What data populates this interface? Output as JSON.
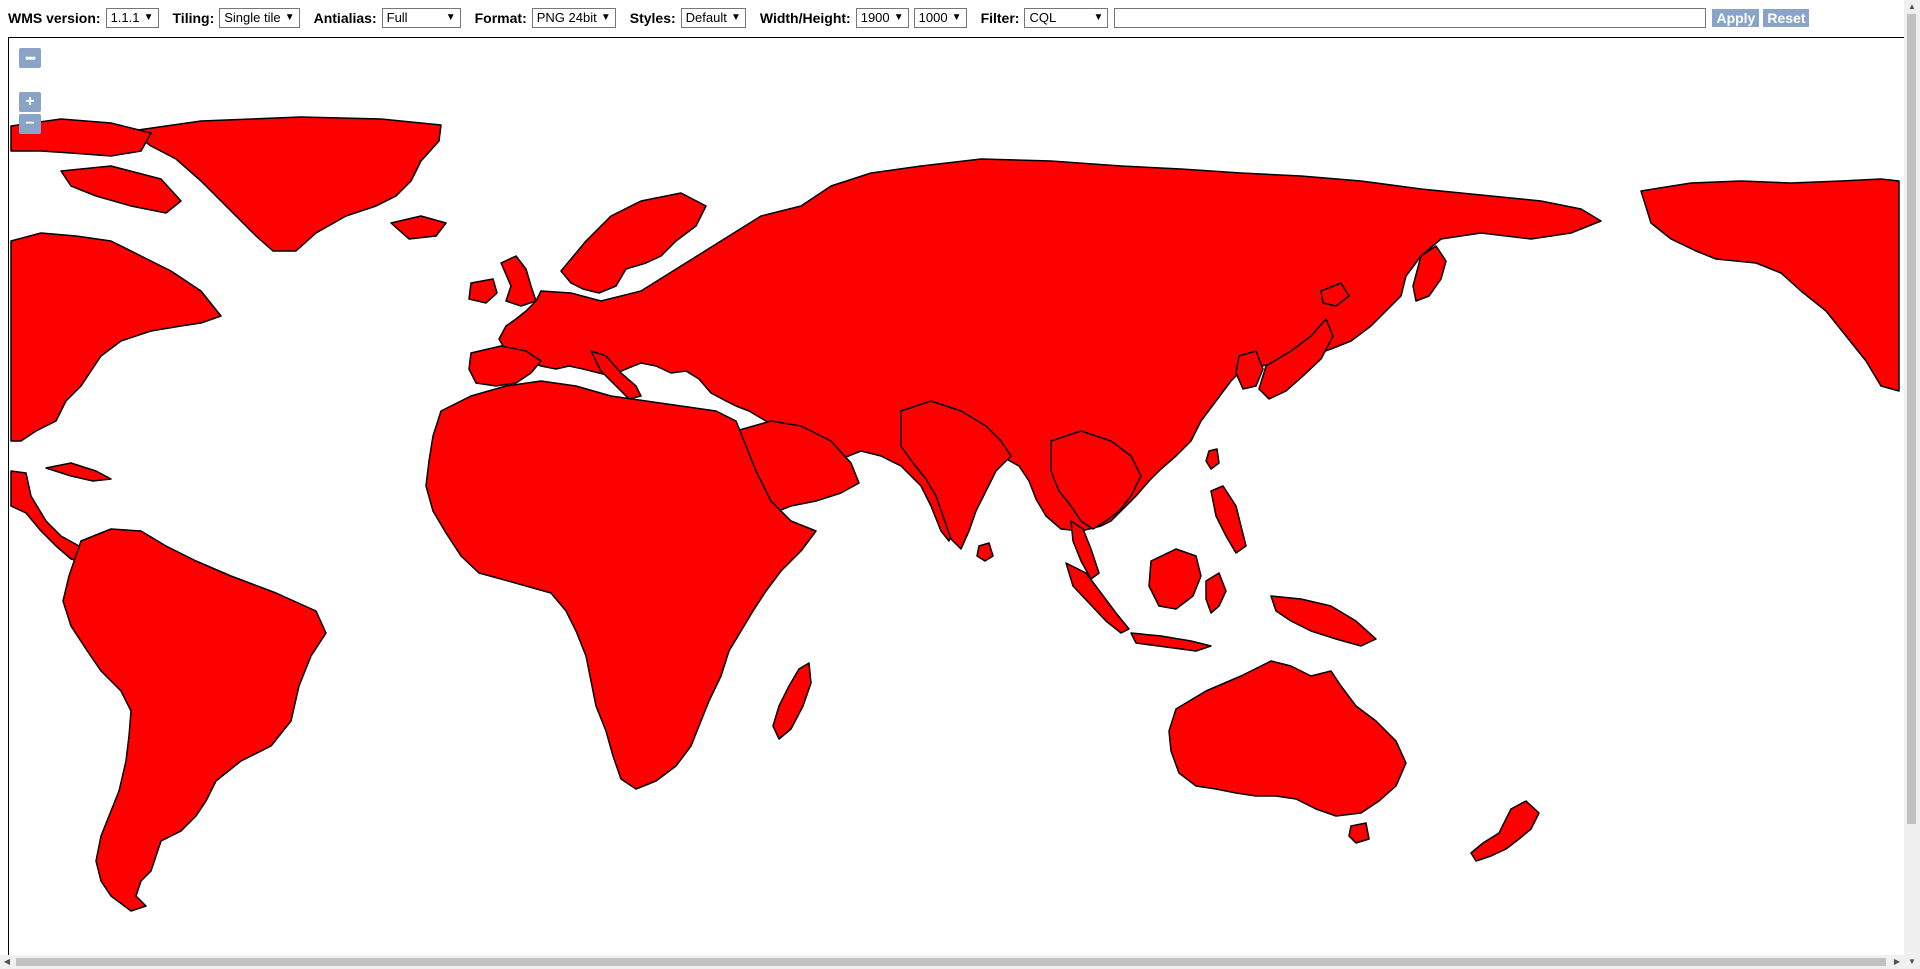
{
  "toolbar": {
    "wms_version": {
      "label": "WMS version:",
      "value": "1.1.1"
    },
    "tiling": {
      "label": "Tiling:",
      "value": "Single tile"
    },
    "antialias": {
      "label": "Antialias:",
      "value": "Full"
    },
    "format": {
      "label": "Format:",
      "value": "PNG 24bit"
    },
    "styles": {
      "label": "Styles:",
      "value": "Default"
    },
    "width_height": {
      "label": "Width/Height:",
      "width": "1900",
      "height": "1000"
    },
    "filter": {
      "label": "Filter:",
      "type": "CQL",
      "value": ""
    },
    "apply_label": "Apply",
    "reset_label": "Reset"
  },
  "map": {
    "controls": {
      "more": "•••",
      "zoom_in": "+",
      "zoom_out": "−"
    },
    "fill_color": "#ff0000",
    "stroke_color": "#000000",
    "background": "#ffffff",
    "accent": "#8aa4c8"
  }
}
